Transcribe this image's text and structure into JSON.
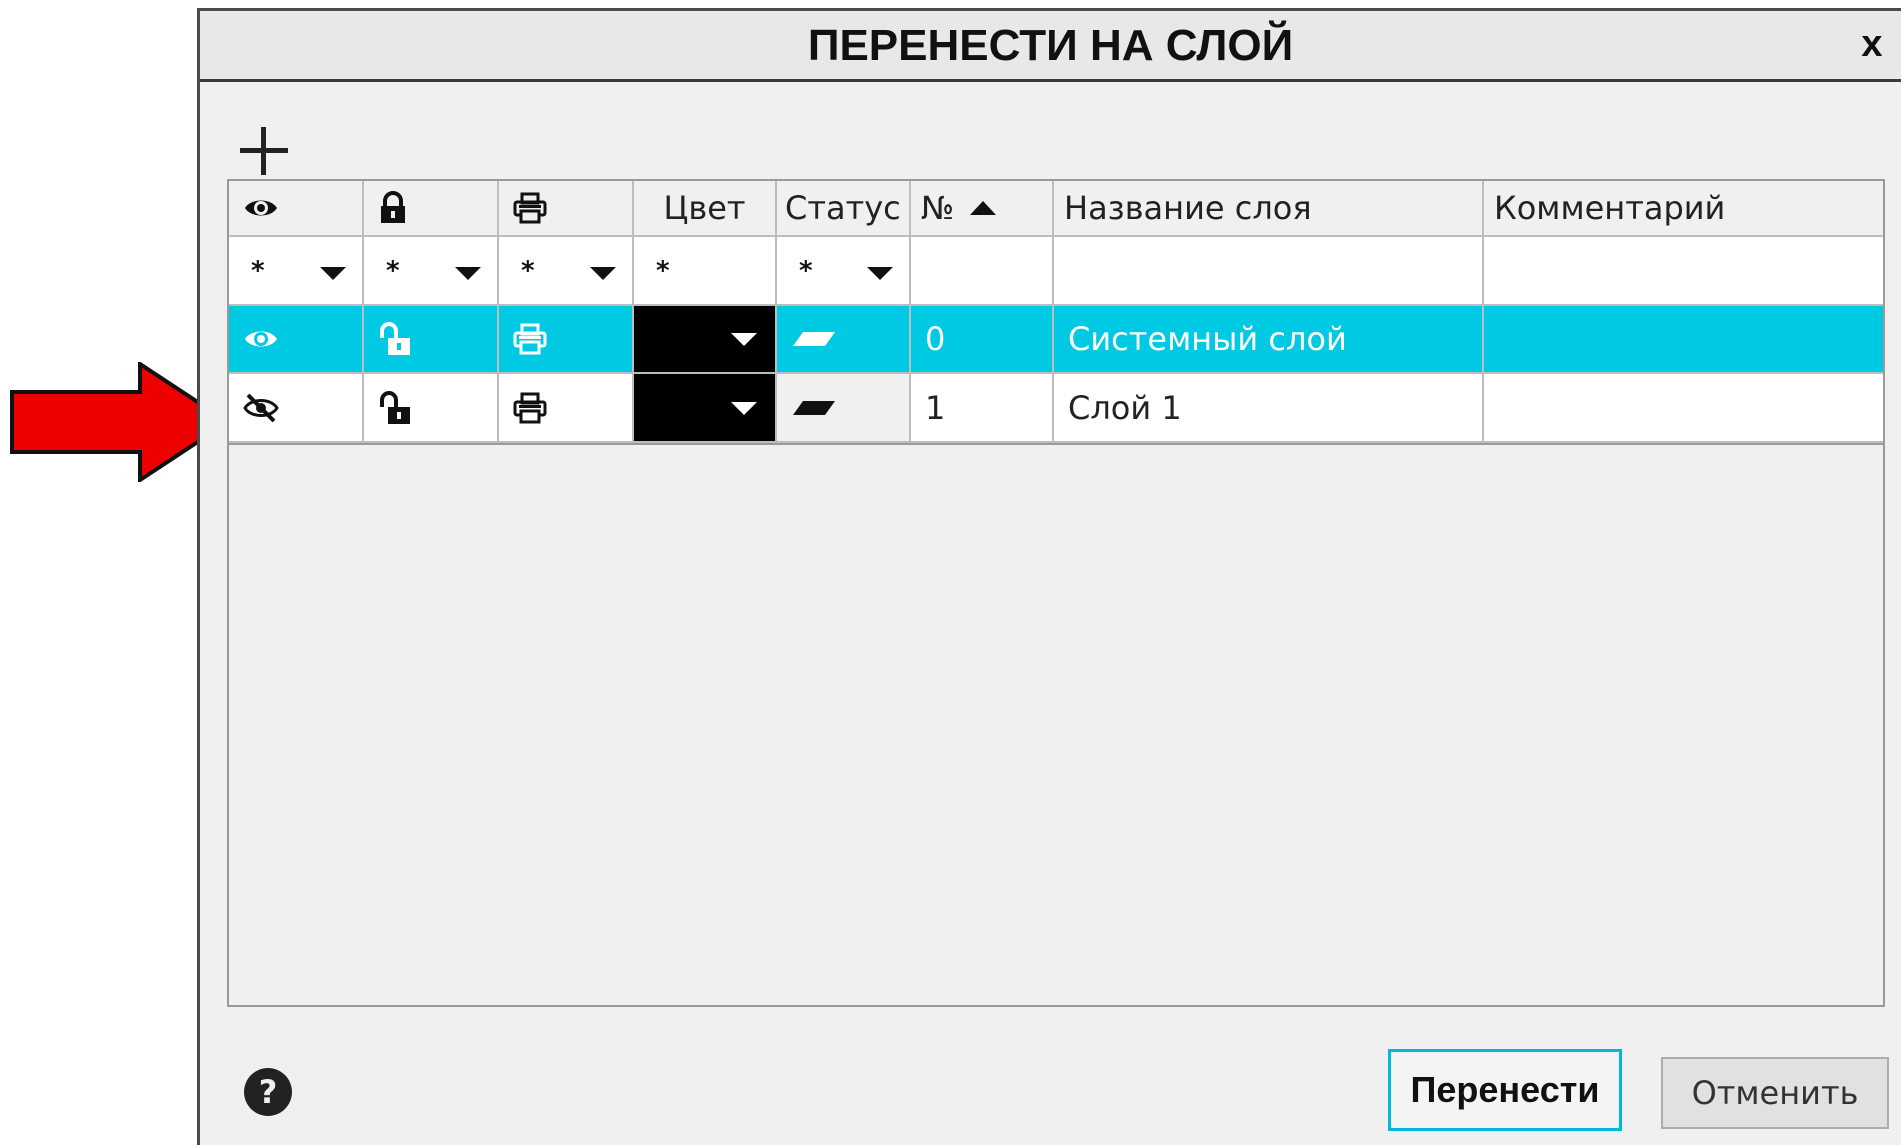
{
  "dialog": {
    "title": "ПЕРЕНЕСТИ НА СЛОЙ",
    "close_label": "x"
  },
  "table": {
    "columns": [
      {
        "key": "visible",
        "icon": "eye-icon"
      },
      {
        "key": "lock",
        "icon": "lock-icon"
      },
      {
        "key": "print",
        "icon": "printer-icon"
      },
      {
        "key": "color",
        "label": "Цвет"
      },
      {
        "key": "status",
        "label": "Статус"
      },
      {
        "key": "number",
        "label": "№",
        "sort": "ascending"
      },
      {
        "key": "name",
        "label": "Название слоя"
      },
      {
        "key": "comment",
        "label": "Комментарий"
      }
    ],
    "filter_value": "*",
    "rows": [
      {
        "visible": true,
        "locked": false,
        "printable": true,
        "color": "#000000",
        "status": "current",
        "number": "0",
        "name": "Системный слой",
        "comment": "",
        "selected": true
      },
      {
        "visible": false,
        "locked": false,
        "printable": true,
        "color": "#000000",
        "status": "active",
        "number": "1",
        "name": "Слой 1",
        "comment": "",
        "selected": false
      }
    ]
  },
  "footer": {
    "ok_label": "Перенести",
    "cancel_label": "Отменить"
  },
  "colors": {
    "selection": "#00c9e4",
    "annotation_arrow": "#ee0000",
    "ok_border": "#00b8d8"
  }
}
